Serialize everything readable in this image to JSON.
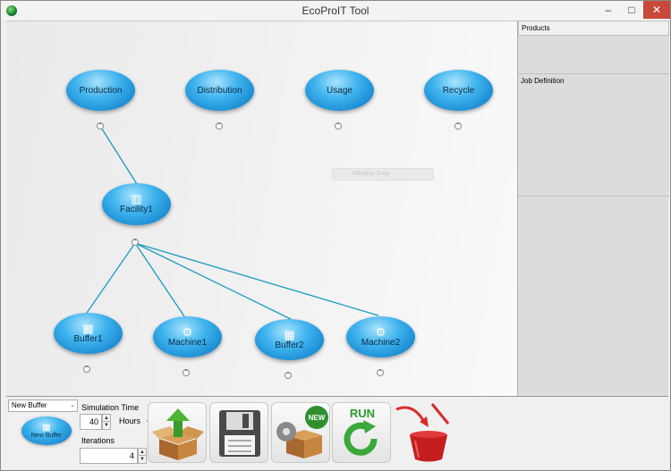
{
  "window": {
    "title": "EcoProIT Tool"
  },
  "canvas": {
    "nodes": {
      "production": "Production",
      "distribution": "Distribution",
      "usage": "Usage",
      "recycle": "Recycle",
      "facility": "Facility1",
      "buffer1": "Buffer1",
      "machine1": "Machine1",
      "buffer2": "Buffer2",
      "machine2": "Machine2"
    },
    "ghost_label": "Window Snip",
    "link_color": "#1b9bbf"
  },
  "right_panel": {
    "products_header": "Products",
    "job_definition_header": "Job Definition"
  },
  "bottom": {
    "node_type_select": "New Buffer",
    "new_node_label": "New Buffer",
    "simulation_time_label": "Simulation Time",
    "simulation_time_value": "40",
    "time_unit": "Hours",
    "iterations_label": "Iterations",
    "iterations_value": "4",
    "run_label": "RUN",
    "new_badge": "NEW"
  },
  "icons": {
    "buffer": "boxes-icon",
    "machine": "gears-icon",
    "facility": "factory-icon"
  }
}
